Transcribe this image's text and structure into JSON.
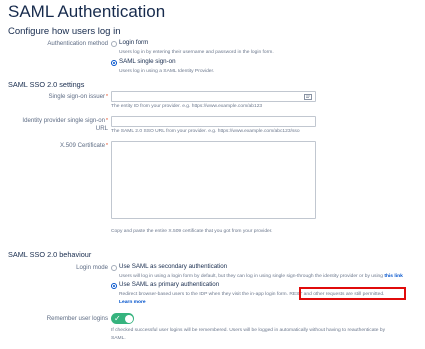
{
  "page_title": "SAML Authentication",
  "login_section": {
    "heading": "Configure how users log in",
    "label": "Authentication method",
    "options": [
      {
        "label": "Login form",
        "desc": "Users log in by entering their username and password in the login form.",
        "selected": false
      },
      {
        "label": "SAML single sign-on",
        "desc": "Users log in using a SAML Identity Provider.",
        "selected": true
      }
    ]
  },
  "settings": {
    "heading": "SAML SSO 2.0 settings",
    "issuer": {
      "label": "Single sign-on issuer",
      "help": "The entity ID from your provider. e.g. https://www.example.com/ab123",
      "value": ""
    },
    "idp_url": {
      "label_line1": "Identity provider single sign-on",
      "label_line2": "URL",
      "help": "The SAML 2.0 SSO URL from your provider. e.g. https://www.example.com/abc123/sso",
      "value": ""
    },
    "cert": {
      "label": "X.509 Certificate",
      "help": "Copy and paste the entire X.509 certificate that you got from your provider.",
      "value": ""
    }
  },
  "behaviour": {
    "heading": "SAML SSO 2.0 behaviour",
    "login_mode_label": "Login mode",
    "secondary": {
      "label": "Use SAML as secondary authentication",
      "desc": "Users will log in using a login form by default, but they can log in using single sign-through the identity provider or by using",
      "link": "this link",
      "selected": false
    },
    "primary": {
      "label": "Use SAML as primary authentication",
      "desc_pre": "Redirect browser-based users to the IDP when they visit the in-app login form.",
      "desc_highlight": "REST and other requests are still permitted.",
      "learn_more": "Learn more",
      "selected": true
    },
    "remember": {
      "label": "Remember user logins",
      "enabled": true,
      "desc_line1": "If checked successful user logins will be remembered. Users will be logged in automatically without having to reauthenticate by",
      "desc_line2": "SAML."
    }
  },
  "colors": {
    "accent": "#0052cc",
    "toggle_on": "#36b37e",
    "highlight": "#e00b0b"
  },
  "icons": {
    "issuer_field": "contact-card-icon",
    "toggle": "check-icon"
  }
}
